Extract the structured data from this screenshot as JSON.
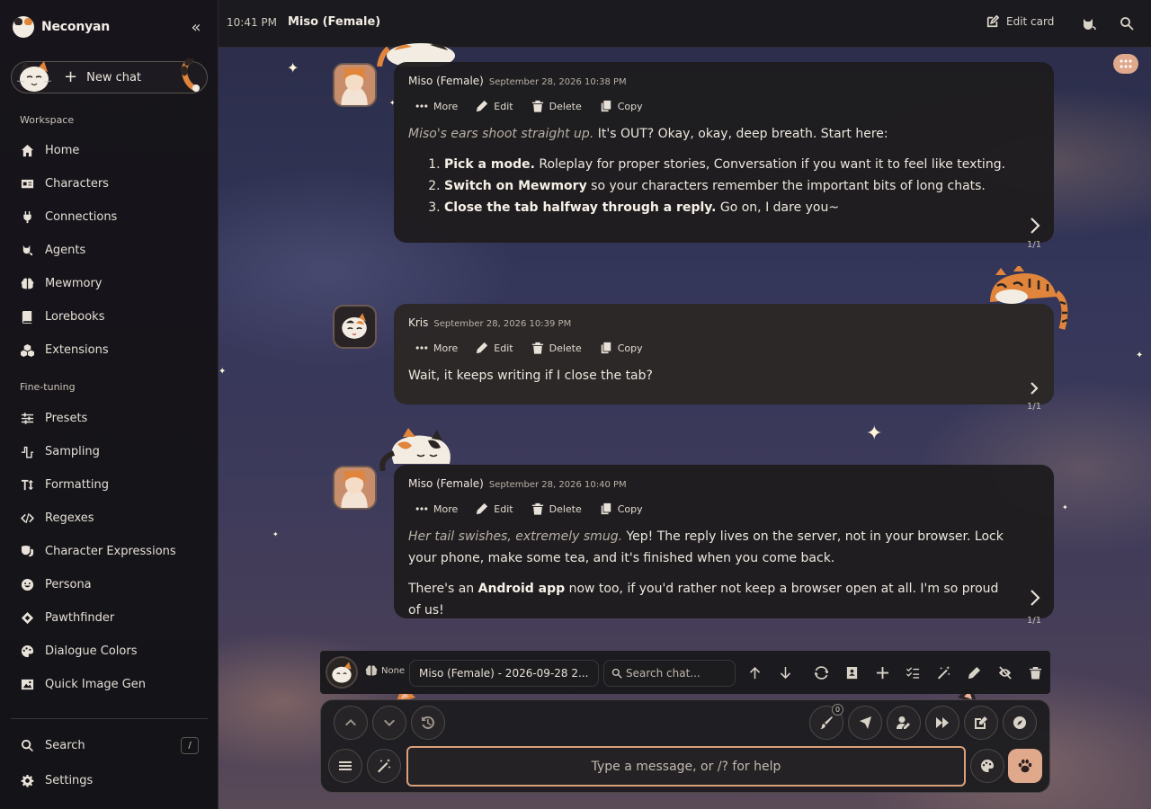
{
  "app": {
    "name": "Neconyan"
  },
  "sidebar": {
    "new_chat_label": "New chat",
    "workspace_label": "Workspace",
    "finetuning_label": "Fine-tuning",
    "workspace_items": [
      {
        "label": "Home",
        "icon": "home-icon"
      },
      {
        "label": "Characters",
        "icon": "id-card-icon"
      },
      {
        "label": "Connections",
        "icon": "plug-icon"
      },
      {
        "label": "Agents",
        "icon": "cat-agent-icon"
      },
      {
        "label": "Mewmory",
        "icon": "brain-icon"
      },
      {
        "label": "Lorebooks",
        "icon": "book-icon"
      },
      {
        "label": "Extensions",
        "icon": "cubes-icon"
      }
    ],
    "finetuning_items": [
      {
        "label": "Presets",
        "icon": "sliders-icon"
      },
      {
        "label": "Sampling",
        "icon": "wave-icon"
      },
      {
        "label": "Formatting",
        "icon": "text-height-icon"
      },
      {
        "label": "Regexes",
        "icon": "code-icon"
      },
      {
        "label": "Character Expressions",
        "icon": "masks-icon"
      },
      {
        "label": "Persona",
        "icon": "smile-icon"
      },
      {
        "label": "Pawthfinder",
        "icon": "compass-diamond-icon"
      },
      {
        "label": "Dialogue Colors",
        "icon": "palette-icon"
      },
      {
        "label": "Quick Image Gen",
        "icon": "image-icon"
      }
    ],
    "bottom_items": {
      "search_label": "Search",
      "search_shortcut": "/",
      "settings_label": "Settings"
    }
  },
  "topbar": {
    "time": "10:41 PM",
    "title": "Miso (Female)",
    "edit_card_label": "Edit card"
  },
  "actions": {
    "more": "More",
    "edit": "Edit",
    "delete": "Delete",
    "copy": "Copy"
  },
  "messages": [
    {
      "author": "Miso (Female)",
      "date": "September 28, 2026 10:38 PM",
      "intro_em": "Miso's ears shoot straight up.",
      "intro_text": " It's OUT? Okay, okay, deep breath. Start here:",
      "list": [
        {
          "bold": "Pick a mode.",
          "text": " Roleplay for proper stories, Conversation if you want it to feel like texting."
        },
        {
          "bold": "Switch on Mewmory",
          "text": " so your characters remember the important bits of long chats."
        },
        {
          "bold": "Close the tab halfway through a reply.",
          "text": " Go on, I dare you~"
        }
      ],
      "swipe": "1/1"
    },
    {
      "author": "Kris",
      "date": "September 28, 2026 10:39 PM",
      "text": "Wait, it keeps writing if I close the tab?",
      "swipe": "1/1"
    },
    {
      "author": "Miso (Female)",
      "date": "September 28, 2026 10:40 PM",
      "p1_em": "Her tail swishes, extremely smug.",
      "p1_text": " Yep! The reply lives on the server, not in your browser. Lock your phone, make some tea, and it's finished when you come back.",
      "p2_pre": "There's an ",
      "p2_bold": "Android app",
      "p2_post": " now too, if you'd rather not keep a browser open at all. I'm so proud of us!",
      "swipe": "1/1"
    }
  ],
  "composer_toolbar": {
    "persona_label": "None",
    "chat_selector": "Miso (Female) - 2026-09-28 2...",
    "search_placeholder": "Search chat..."
  },
  "composer": {
    "placeholder": "Type a message, or /? for help",
    "brush_badge": "0"
  },
  "colors": {
    "accent": "#e0a98c",
    "input_border": "#d9a07c",
    "sidebar_bg": "#17151b"
  }
}
